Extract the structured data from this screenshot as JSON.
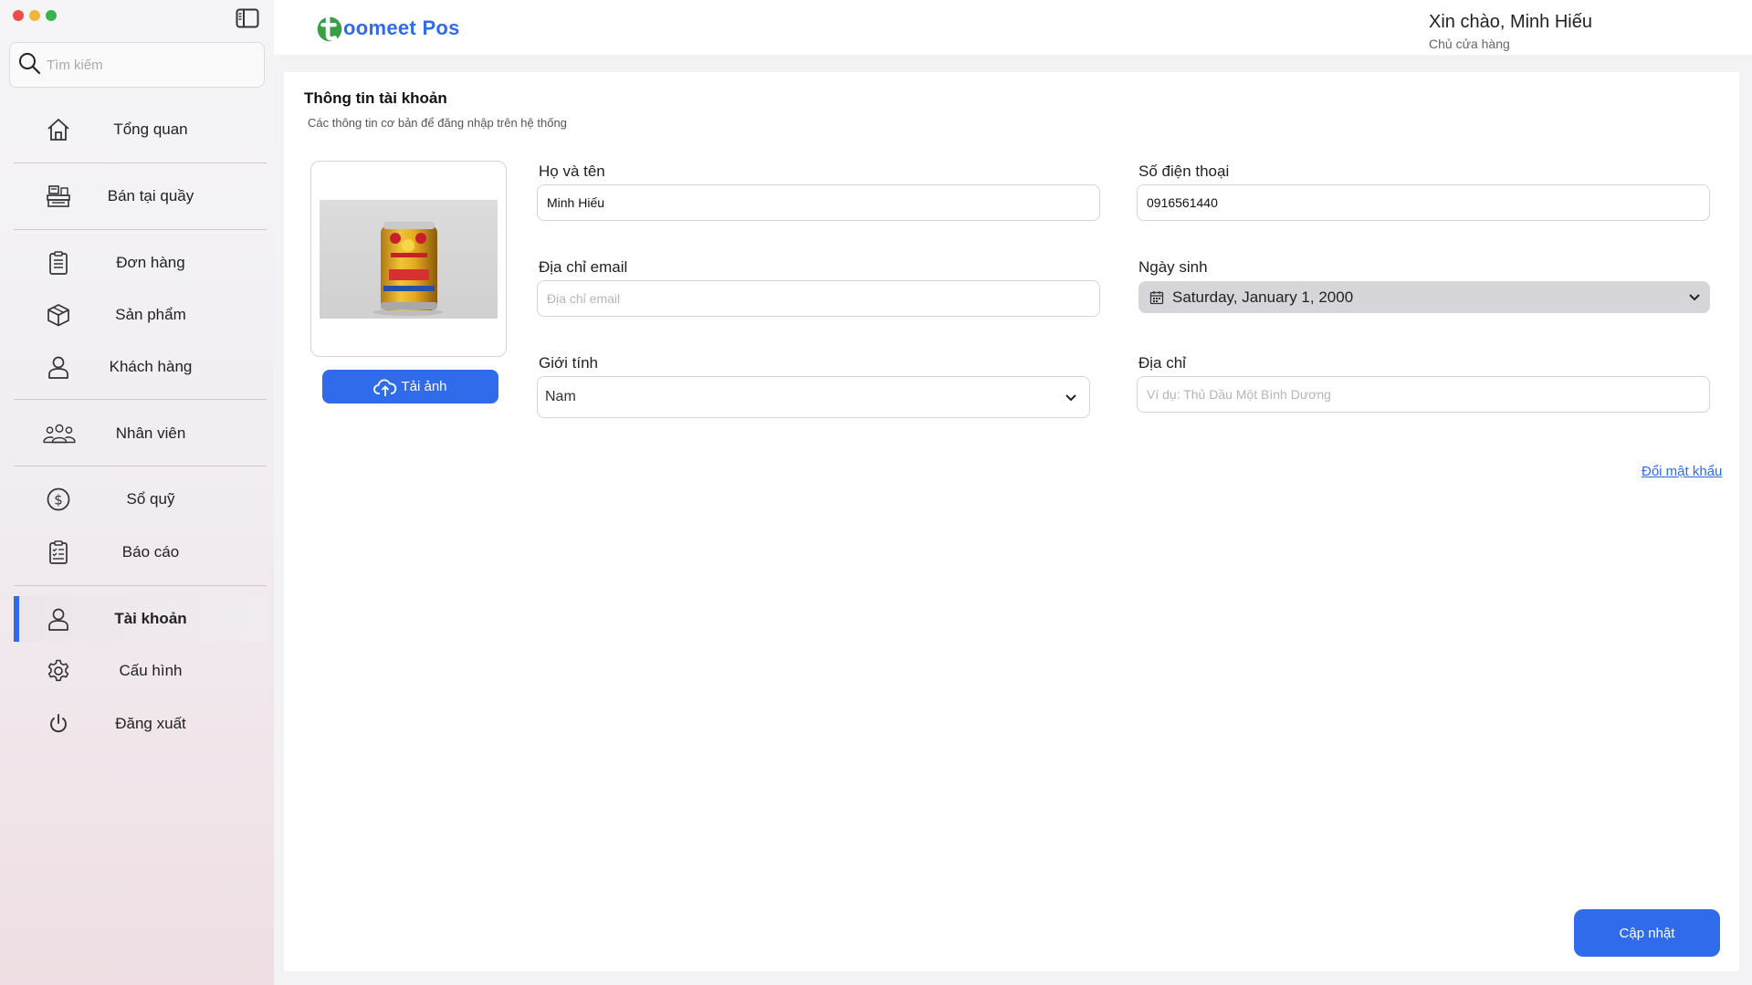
{
  "app": {
    "name": "Toomeet Pos",
    "logo_text": "oomeet Pos",
    "accent": "#2f6bea"
  },
  "search": {
    "placeholder": "Tìm kiếm"
  },
  "sidebar": {
    "items": [
      {
        "label": "Tổng quan",
        "icon": "home-icon"
      },
      {
        "label": "Bán tại quầy",
        "icon": "pos-counter-icon"
      },
      {
        "label": "Đơn hàng",
        "icon": "order-clipboard-icon"
      },
      {
        "label": "Sản phẩm",
        "icon": "box-icon"
      },
      {
        "label": "Khách hàng",
        "icon": "user-icon"
      },
      {
        "label": "Nhân viên",
        "icon": "team-icon"
      },
      {
        "label": "Sổ quỹ",
        "icon": "dollar-circle-icon"
      },
      {
        "label": "Báo cáo",
        "icon": "report-icon"
      },
      {
        "label": "Tài khoản",
        "icon": "account-icon",
        "active": true
      },
      {
        "label": "Cấu hình",
        "icon": "gear-icon"
      },
      {
        "label": "Đăng xuất",
        "icon": "power-icon"
      }
    ]
  },
  "header": {
    "greeting": "Xin chào, Minh Hiếu",
    "role": "Chủ cửa hàng"
  },
  "account": {
    "title": "Thông tin tài khoản",
    "subtitle": "Các thông tin cơ bản để đăng nhập trên hệ thống",
    "upload_label": "Tải ảnh",
    "fullname": {
      "label": "Họ và tên",
      "value": "Minh Hiếu"
    },
    "phone": {
      "label": "Số điện thoại",
      "value": "0916561440"
    },
    "email": {
      "label": "Địa chỉ email",
      "value": "",
      "placeholder": "Địa chỉ email"
    },
    "birthday": {
      "label": "Ngày sinh",
      "value": "Saturday, January 1, 2000"
    },
    "gender": {
      "label": "Giới tính",
      "value": "Nam"
    },
    "address": {
      "label": "Địa chỉ",
      "value": "",
      "placeholder": "Ví dụ: Thủ Dầu Một Bình Dương"
    },
    "change_password": "Đổi mật khẩu",
    "update_label": "Cập nhật"
  }
}
